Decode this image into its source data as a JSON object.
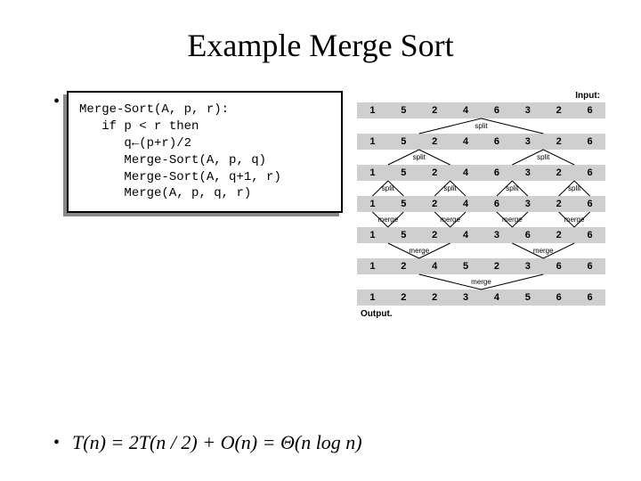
{
  "title": "Example Merge Sort",
  "code": {
    "l1": "Merge-Sort(A, p, r):",
    "l2": "   if p < r then",
    "l3": "      q←(p+r)/2",
    "l4": "      Merge-Sort(A, p, q)",
    "l5": "      Merge-Sort(A, q+1, r)",
    "l6": "      Merge(A, p, q, r)"
  },
  "diagram": {
    "input_label": "Input:",
    "output_label": "Output.",
    "op_split": "split",
    "op_merge": "merge",
    "rows": {
      "r0": [
        "1",
        "5",
        "2",
        "4",
        "6",
        "3",
        "2",
        "6"
      ],
      "r1": [
        "1",
        "5",
        "2",
        "4",
        "6",
        "3",
        "2",
        "6"
      ],
      "r2": [
        "1",
        "5",
        "2",
        "4",
        "6",
        "3",
        "2",
        "6"
      ],
      "r3": [
        "1",
        "5",
        "2",
        "4",
        "6",
        "3",
        "2",
        "6"
      ],
      "r4": [
        "1",
        "5",
        "2",
        "4",
        "3",
        "6",
        "2",
        "6"
      ],
      "r5": [
        "1",
        "2",
        "4",
        "5",
        "2",
        "3",
        "6",
        "6"
      ],
      "r6": [
        "1",
        "2",
        "2",
        "3",
        "4",
        "5",
        "6",
        "6"
      ]
    }
  },
  "formula": {
    "text": "T(n) = 2T(n / 2) + O(n) = Θ(n log n)"
  }
}
